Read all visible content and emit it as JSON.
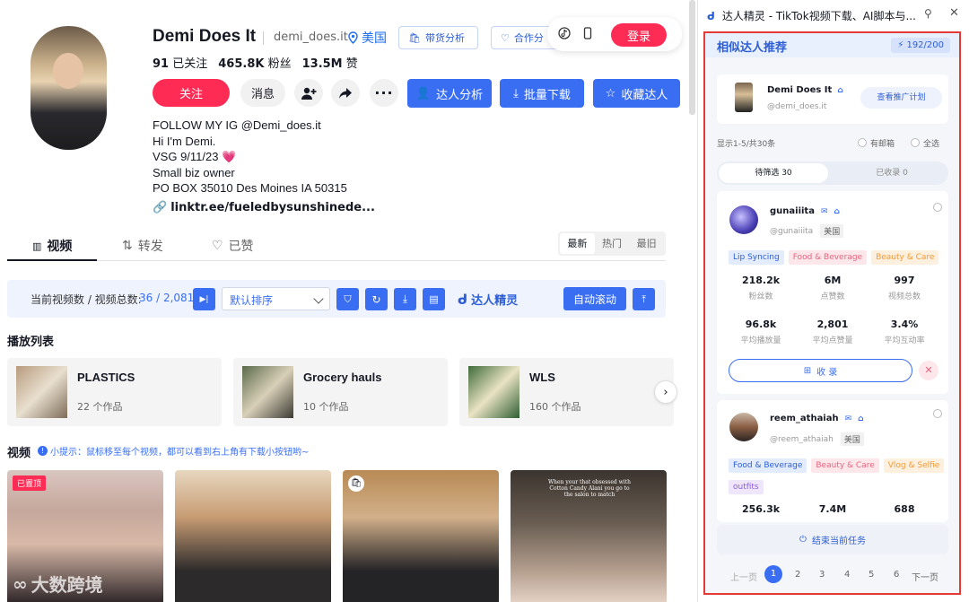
{
  "profile": {
    "name": "Demi Does It",
    "handle": "demi_does.it",
    "location": "美国",
    "btn_goods": "带货分析",
    "btn_coop": "合作分",
    "login": "登录",
    "following_num": "91",
    "following_lbl": "已关注",
    "followers_num": "465.8K",
    "followers_lbl": "粉丝",
    "likes_num": "13.5M",
    "likes_lbl": "赞",
    "follow_btn": "关注",
    "msg_btn": "消息",
    "btn_analysis": "达人分析",
    "btn_download": "批量下载",
    "btn_collect": "收藏达人",
    "bio": [
      "FOLLOW MY IG @Demi_does.it",
      "Hi I'm Demi.",
      "VSG 9/11/23 💗",
      "Small biz owner",
      "PO BOX 35010 Des Moines IA 50315"
    ],
    "link": "linktr.ee/fueledbysunshinede..."
  },
  "tabs": [
    {
      "label": "视频"
    },
    {
      "label": "转发"
    },
    {
      "label": "已赞"
    }
  ],
  "sort_tabs": [
    "最新",
    "热门",
    "最旧"
  ],
  "toolbar": {
    "label": "当前视频数 / 视频总数:",
    "count": "36 / 2,081",
    "sort": "默认排序",
    "brand": "达人精灵",
    "auto": "自动滚动"
  },
  "playlist_title": "播放列表",
  "playlists": [
    {
      "title": "PLASTICS",
      "count": "22 个作品"
    },
    {
      "title": "Grocery hauls",
      "count": "10 个作品"
    },
    {
      "title": "WLS",
      "count": "160 个作品"
    }
  ],
  "videos_title": "视频",
  "videos_hint": "小提示：鼠标移至每个视频，都可以看到右上角有下载小按钮哟~",
  "pinned": "已置顶",
  "video4_text": "When your that obsessed with Cotton Candy Alani you go to the salon to match",
  "watermark": "大数跨境",
  "panel": {
    "ext_title": "达人精灵 - TikTok视频下载、AI脚本与...",
    "header": "相似达人推荐",
    "quota": "192/200",
    "main_name": "Demi Does It",
    "main_handle": "@demi_does.it",
    "promo_btn": "查看推广计划",
    "showing": "显示1-5/共30条",
    "has_email": "有邮箱",
    "select_all": "全选",
    "seg_pending": "待筛选 30",
    "seg_collected": "已收录 0",
    "creators": [
      {
        "name": "gunaiiita",
        "handle": "@gunaiiita",
        "country": "美国",
        "tags": [
          "Lip Syncing",
          "Food & Beverage",
          "Beauty & Care"
        ],
        "metrics": [
          {
            "v": "218.2k",
            "k": "粉丝数"
          },
          {
            "v": "6M",
            "k": "点赞数"
          },
          {
            "v": "997",
            "k": "视频总数"
          },
          {
            "v": "96.8k",
            "k": "平均播放量"
          },
          {
            "v": "2,801",
            "k": "平均点赞量"
          },
          {
            "v": "3.4%",
            "k": "平均互动率"
          }
        ],
        "collect": "收 录"
      },
      {
        "name": "reem_athaiah",
        "handle": "@reem_athaiah",
        "country": "美国",
        "tags": [
          "Food & Beverage",
          "Beauty & Care",
          "Vlog & Selfie",
          "outfits"
        ],
        "metrics": [
          {
            "v": "256.3k"
          },
          {
            "v": "7.4M"
          },
          {
            "v": "688"
          }
        ]
      }
    ],
    "end_task": "结束当前任务",
    "prev": "上一页",
    "next": "下一页",
    "pages": [
      "1",
      "2",
      "3",
      "4",
      "5",
      "6"
    ]
  },
  "colors": {
    "tiktok_red": "#fe2c55",
    "accent_blue": "#3a6ef2",
    "highlight_border": "#e53935"
  }
}
